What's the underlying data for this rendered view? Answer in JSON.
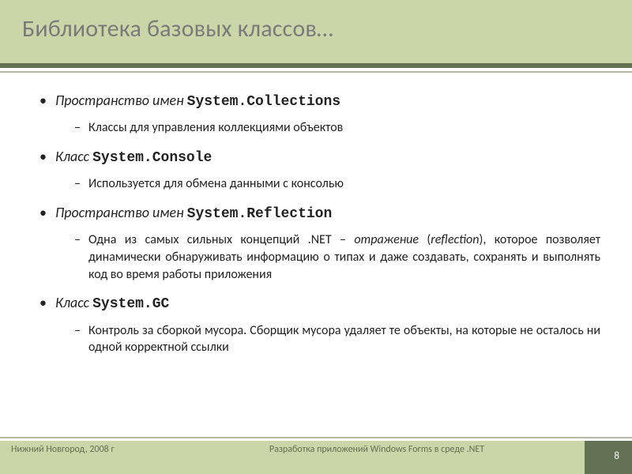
{
  "title": "Библиотека базовых классов…",
  "bullets": [
    {
      "intro": "Пространство имен ",
      "code": "System.Collections",
      "sub": [
        {
          "text": "Классы для управления коллекциями объектов"
        }
      ]
    },
    {
      "intro": "Класс ",
      "code": "System.Console",
      "sub": [
        {
          "text": "Используется для обмена данными с консолью"
        }
      ]
    },
    {
      "intro": "Пространство имен ",
      "code": "System.Reflection",
      "sub": [
        {
          "pre": "Одна из самых сильных концепций .NET – ",
          "em": "отражение",
          "paren": " (",
          "em2": "reflection",
          "post": "), которое позволяет динамически обнаруживать информацию о типах и даже создавать, сохранять и выполнять код во время работы приложения"
        }
      ]
    },
    {
      "intro": "Класс ",
      "code": "System.GC",
      "sub": [
        {
          "text": "Контроль за сборкой мусора. Сборщик мусора удаляет те объекты, на которые не осталось ни одной корректной ссылки"
        }
      ]
    }
  ],
  "footer": {
    "left": "Нижний Новгород, 2008 г",
    "center": "Разработка приложений Windows Forms в среде .NET",
    "page": "8"
  }
}
